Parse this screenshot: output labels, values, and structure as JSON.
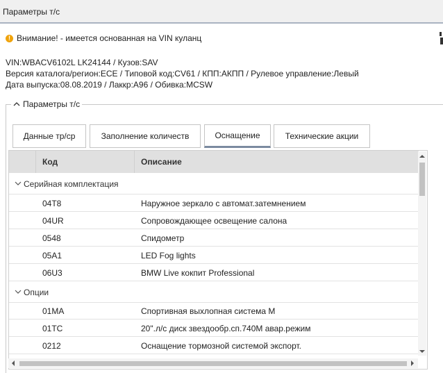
{
  "window": {
    "title": "Параметры т/с"
  },
  "warning": {
    "text": "Внимание! - имеется основанная на VIN куланц"
  },
  "vehicle_info": {
    "line1": "VIN:WBACV6102L LK24144 / Кузов:SAV",
    "line2": "Версия каталога/регион:ECE / Типовой код:CV61 / КПП:АКПП / Рулевое управление:Левый",
    "line3": "Дата выпуска:08.08.2019 / Лаккр:A96 / Обивка:MCSW"
  },
  "section": {
    "title": "Параметры т/с"
  },
  "tabs": [
    {
      "label": "Данные тр/ср"
    },
    {
      "label": "Заполнение количеств"
    },
    {
      "label": "Оснащение",
      "active": true
    },
    {
      "label": "Технические акции"
    }
  ],
  "table": {
    "columns": {
      "code": "Код",
      "description": "Описание"
    },
    "groups": [
      {
        "label": "Серийная комплектация",
        "rows": [
          {
            "code": "04T8",
            "description": "Наружное зеркало с автомат.затемнением"
          },
          {
            "code": "04UR",
            "description": "Сопровождающее освещение салона"
          },
          {
            "code": "0548",
            "description": "Спидометр"
          },
          {
            "code": "05A1",
            "description": "LED Fog lights"
          },
          {
            "code": "06U3",
            "description": "BMW Live кокпит Professional"
          }
        ]
      },
      {
        "label": "Опции",
        "rows": [
          {
            "code": "01MA",
            "description": "Спортивная выхлопная система M"
          },
          {
            "code": "01TC",
            "description": "20\".л/с диск звездообр.сп.740M авар.режим"
          },
          {
            "code": "0212",
            "description": "Оснащение тормозной системой экспорт."
          }
        ]
      }
    ]
  },
  "colors": {
    "warning_icon": "#f0a30a",
    "header_bg": "#e0e0e0",
    "active_tab_underline": "#7b8aa0"
  }
}
